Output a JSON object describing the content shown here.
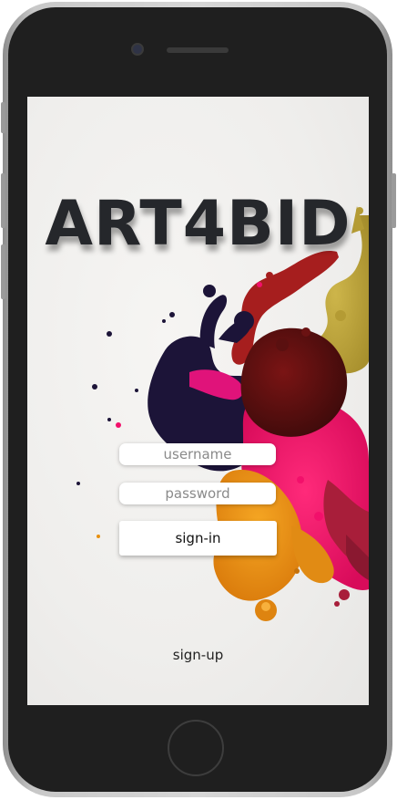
{
  "app": {
    "title": "ART4BID"
  },
  "login": {
    "username_placeholder": "username",
    "password_placeholder": "password",
    "signin_label": "sign-in",
    "signup_label": "sign-up"
  },
  "colors": {
    "title": "#25272b",
    "paint_navy": "#1c1438",
    "paint_magenta": "#f2106b",
    "paint_red": "#9e1f1f",
    "paint_gold": "#b9a13a",
    "paint_orange": "#e8900f"
  }
}
